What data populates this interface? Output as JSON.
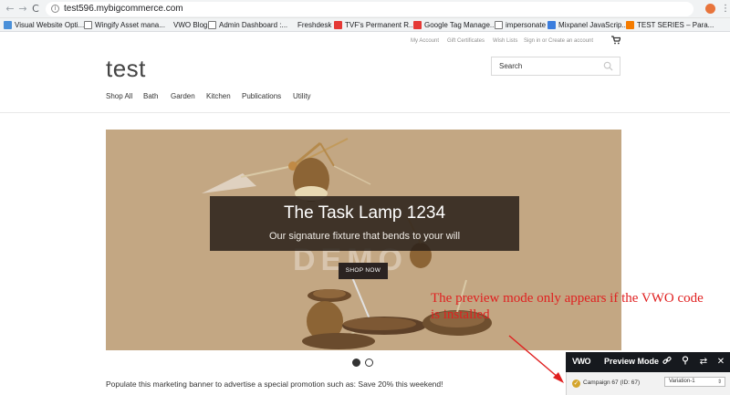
{
  "browser": {
    "url": "test596.mybigcommerce.com",
    "bookmarks": [
      {
        "label": "Visual Website Opti..."
      },
      {
        "label": "Wingify Asset mana..."
      },
      {
        "label": "VWO Blog"
      },
      {
        "label": "Admin Dashboard :..."
      },
      {
        "label": "Freshdesk"
      },
      {
        "label": "TVF's Permanent R..."
      },
      {
        "label": "Google Tag Manage..."
      },
      {
        "label": "impersonate"
      },
      {
        "label": "Mixpanel JavaScrip..."
      },
      {
        "label": "TEST SERIES – Para..."
      }
    ]
  },
  "store": {
    "utility_links": [
      "My Account",
      "Gift Certificates",
      "Wish Lists",
      "Sign in or Create an account"
    ],
    "logo": "test",
    "search_placeholder": "Search",
    "categories": [
      "Shop All",
      "Bath",
      "Garden",
      "Kitchen",
      "Publications",
      "Utility"
    ],
    "hero": {
      "title": "The Task Lamp 1234",
      "subtitle": "Our signature fixture that bends to your will",
      "watermark": "DEMO",
      "button": "SHOP NOW",
      "bg_color": "#c3a783"
    },
    "promo": "Populate this marketing banner to advertise a special promotion such as: Save 20% this weekend!"
  },
  "annotation": {
    "text": "The preview mode only appears if the VWO code is installed",
    "color": "#e02020"
  },
  "vwo": {
    "logo": "VWO",
    "title": "Preview Mode",
    "campaign": "Campaign 67 (ID: 67)",
    "variation": "Variation-1"
  }
}
